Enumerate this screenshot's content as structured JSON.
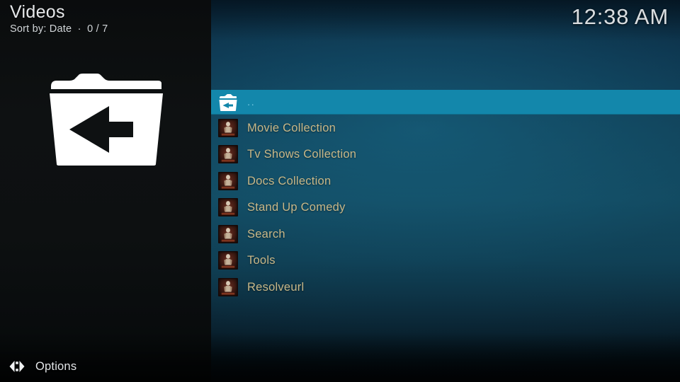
{
  "window": {
    "title": "Videos",
    "subtitle": "Sort by: Date  ·  0 / 7",
    "clock": "12:38 AM"
  },
  "artwork": {
    "icon": "folder-back-icon"
  },
  "list": {
    "selected_index": 0,
    "items": [
      {
        "label": "..",
        "icon": "folder-back-icon",
        "selected": true
      },
      {
        "label": "Movie Collection",
        "icon": "addon-thumbnail-icon",
        "selected": false
      },
      {
        "label": "Tv Shows Collection",
        "icon": "addon-thumbnail-icon",
        "selected": false
      },
      {
        "label": "Docs Collection",
        "icon": "addon-thumbnail-icon",
        "selected": false
      },
      {
        "label": "Stand Up Comedy",
        "icon": "addon-thumbnail-icon",
        "selected": false
      },
      {
        "label": "Search",
        "icon": "addon-thumbnail-icon",
        "selected": false
      },
      {
        "label": "Tools",
        "icon": "addon-thumbnail-icon",
        "selected": false
      },
      {
        "label": "Resolveurl",
        "icon": "addon-thumbnail-icon",
        "selected": false
      }
    ]
  },
  "footer": {
    "options_label": "Options",
    "options_icon": "left-right-arrows-icon"
  },
  "colors": {
    "selection": "#1387ab",
    "list_text": "#c8b889",
    "selected_text": "#6fc4de",
    "header_text": "#e6e8ea",
    "background_top": "#0d3049",
    "background_mid": "#134a60",
    "background_bottom": "#030a10",
    "left_panel": "#0e1112"
  }
}
